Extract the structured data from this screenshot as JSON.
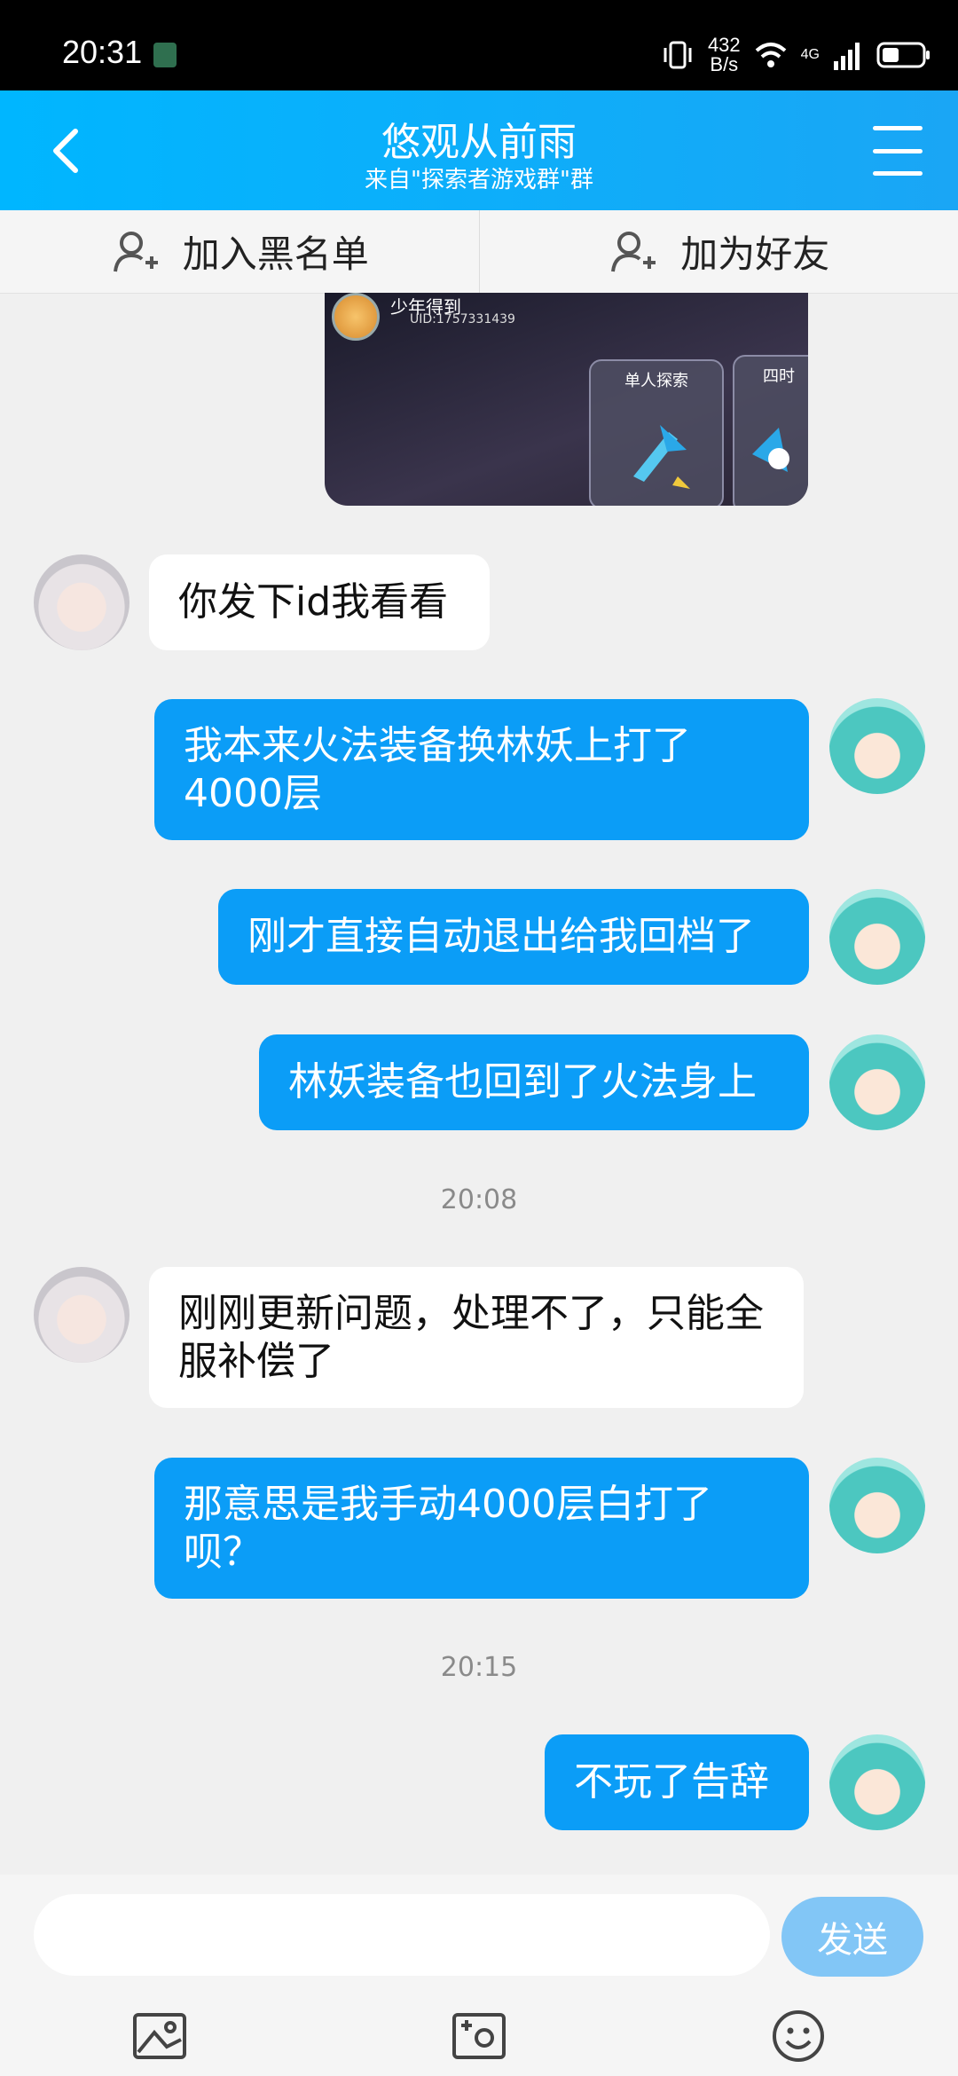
{
  "status_bar": {
    "time": "20:31",
    "speed_value": "432",
    "speed_unit": "B/s",
    "network": "4G"
  },
  "header": {
    "title": "悠观从前雨",
    "subtitle": "来自\"探索者游戏群\"群"
  },
  "actions": {
    "blacklist": "加入黑名单",
    "add_friend": "加为好友"
  },
  "image_message": {
    "username": "少年得到",
    "uid": "UID:1757331439",
    "card1": "单人探索",
    "card2": "四时"
  },
  "messages": [
    {
      "side": "left",
      "text": "你发下id我看看"
    },
    {
      "side": "right",
      "text": "我本来火法装备换林妖上打了4000层"
    },
    {
      "side": "right",
      "text": "刚才直接自动退出给我回档了"
    },
    {
      "side": "right",
      "text": "林妖装备也回到了火法身上"
    },
    {
      "side": "left",
      "text": "刚刚更新问题，处理不了，只能全服补偿了"
    },
    {
      "side": "right",
      "text": "那意思是我手动4000层白打了呗？"
    },
    {
      "side": "right",
      "text": "不玩了告辞"
    }
  ],
  "timestamps": [
    "20:08",
    "20:15"
  ],
  "input": {
    "send_label": "发送"
  },
  "colors": {
    "header": "#12aef8",
    "bubble_right": "#0b9df7",
    "send_button": "#82c6f6"
  },
  "icons": [
    "back-icon",
    "menu-icon",
    "add-user-icon",
    "image-icon",
    "camera-icon",
    "emoji-icon"
  ]
}
